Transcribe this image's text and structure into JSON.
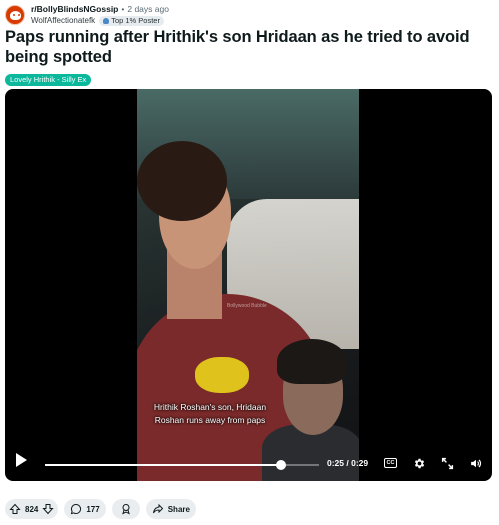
{
  "post": {
    "subreddit": "r/BollyBlindsNGossip",
    "time": "2 days ago",
    "author": "WolfAffectionatefk",
    "author_badge": "Top 1% Poster",
    "title": "Paps running after Hrithik's son Hridaan as he tried to avoid being spotted",
    "flair": "Lovely Hrithik - Silly Ex",
    "flair_color": "#0cb89b"
  },
  "video": {
    "caption_line1": "Hrithik Roshan's son, Hridaan",
    "caption_line2": "Roshan runs away from paps",
    "current_time": "0:25",
    "duration": "0:29",
    "timecode": "0:25 / 0:29",
    "progress": 0.862,
    "cc_label": "CC",
    "watermark": "Bollywood Bubble",
    "icons": [
      "play-icon",
      "cc-icon",
      "gear-icon",
      "fullscreen-icon",
      "volume-icon"
    ]
  },
  "actions": {
    "upvotes": "824",
    "comments": "177",
    "share_label": "Share",
    "icons": [
      "upvote-icon",
      "downvote-icon",
      "comment-icon",
      "award-icon",
      "share-icon"
    ]
  }
}
